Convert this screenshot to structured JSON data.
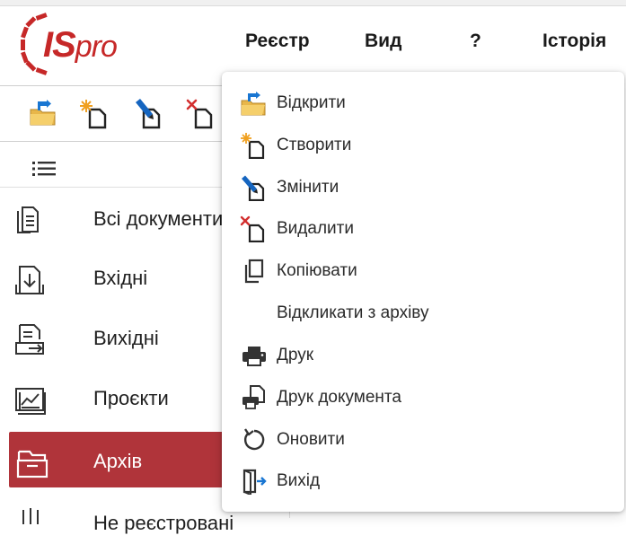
{
  "app": {
    "logo_text_is": "IS",
    "logo_text_pro": "pro",
    "brand_color": "#c62828"
  },
  "menubar": {
    "items": [
      {
        "label": "Реєстр"
      },
      {
        "label": "Вид"
      },
      {
        "label": "?"
      },
      {
        "label": "Історія"
      }
    ]
  },
  "toolbar": {
    "buttons": [
      {
        "icon": "open-folder-icon"
      },
      {
        "icon": "create-document-icon"
      },
      {
        "icon": "edit-document-icon"
      },
      {
        "icon": "delete-document-icon"
      }
    ]
  },
  "sidebar": {
    "items": [
      {
        "label": "Всі документи",
        "icon": "all-documents-icon",
        "active": false
      },
      {
        "label": "Вхідні",
        "icon": "incoming-icon",
        "active": false
      },
      {
        "label": "Вихідні",
        "icon": "outgoing-icon",
        "active": false
      },
      {
        "label": "Проєкти",
        "icon": "projects-icon",
        "active": false
      },
      {
        "label": "Архів",
        "icon": "archive-icon",
        "active": true
      },
      {
        "label": "Не реєстровані",
        "icon": "unregistered-icon",
        "active": false
      }
    ],
    "active_color": "#b0343a"
  },
  "dropdown": {
    "items": [
      {
        "label": "Відкрити",
        "icon": "open-folder-icon"
      },
      {
        "label": "Створити",
        "icon": "create-document-icon"
      },
      {
        "label": "Змінити",
        "icon": "edit-document-icon"
      },
      {
        "label": "Видалити",
        "icon": "delete-document-icon"
      },
      {
        "label": "Копіювати",
        "icon": "copy-icon"
      },
      {
        "label": "Відкликати з архіву",
        "icon": ""
      },
      {
        "label": "Друк",
        "icon": "printer-icon"
      },
      {
        "label": "Друк документа",
        "icon": "print-document-icon"
      },
      {
        "label": "Оновити",
        "icon": "refresh-icon"
      },
      {
        "label": "Вихід",
        "icon": "exit-icon"
      }
    ]
  }
}
